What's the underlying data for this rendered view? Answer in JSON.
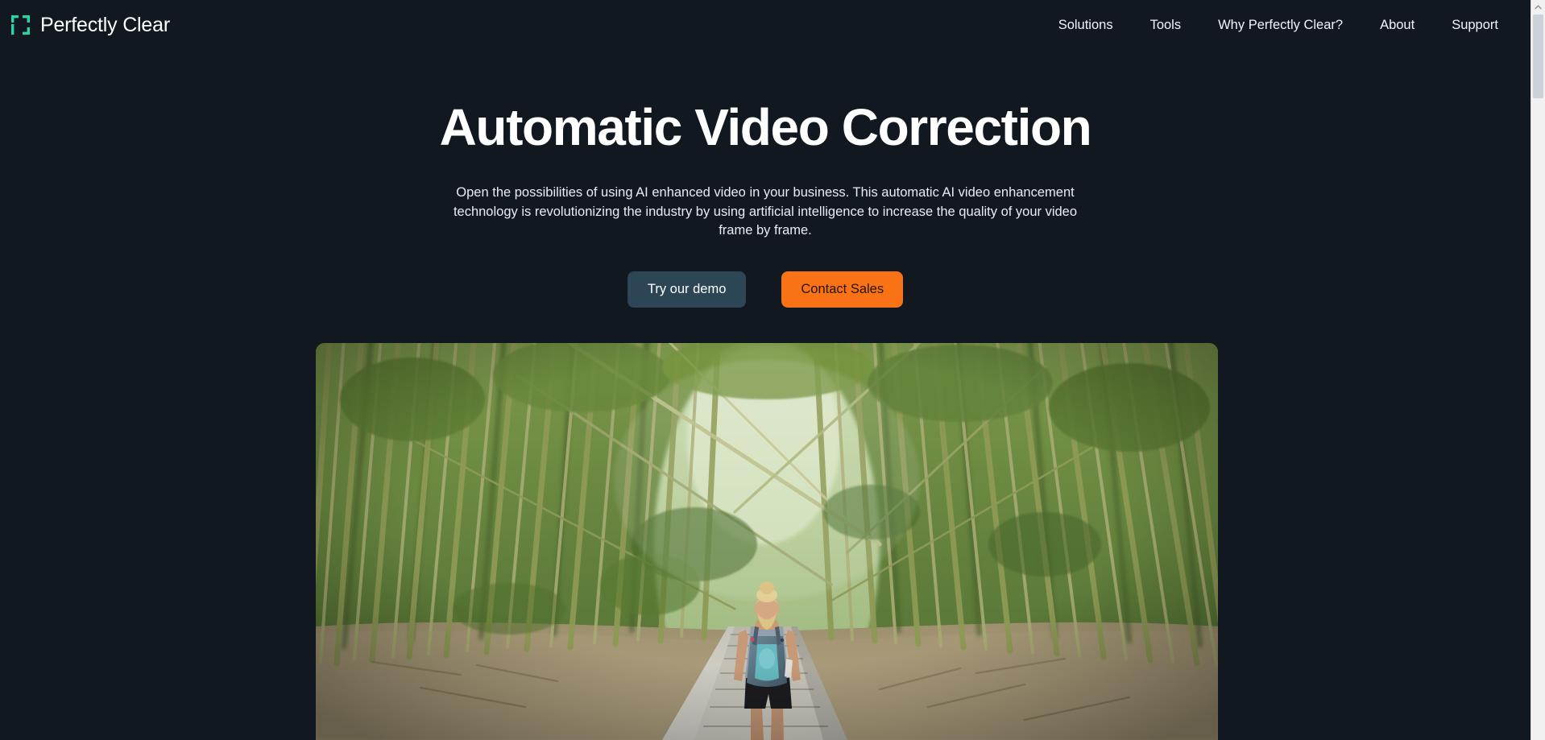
{
  "theme": {
    "background": "#111820",
    "text_primary": "#ffffff",
    "text_secondary": "#e9edf1",
    "brand_teal": "#2ad4a5",
    "accent_orange": "#f97316",
    "demo_button_bg": "#2d4656",
    "scrollbar_track": "#f1f1f1",
    "scrollbar_thumb": "#cdd2d9"
  },
  "header": {
    "logo_icon": "bracket-frame-icon",
    "brand_name": "Perfectly Clear",
    "nav": [
      {
        "label": "Solutions"
      },
      {
        "label": "Tools"
      },
      {
        "label": "Why Perfectly Clear?"
      },
      {
        "label": "About"
      },
      {
        "label": "Support"
      }
    ]
  },
  "hero": {
    "title": "Automatic Video Correction",
    "subtitle": "Open the possibilities of using AI enhanced video in your business. This automatic AI video enhancement technology is revolutionizing the industry by using artificial intelligence to increase the quality of your video frame by frame.",
    "primary_button": "Try our demo",
    "secondary_button": "Contact Sales"
  },
  "media": {
    "description": "Video of a hiker with a teal backpack walking a wooden boardwalk through a dense bamboo forest"
  },
  "scrollbar": {
    "up_arrow_icon": "chevron-up-icon"
  }
}
